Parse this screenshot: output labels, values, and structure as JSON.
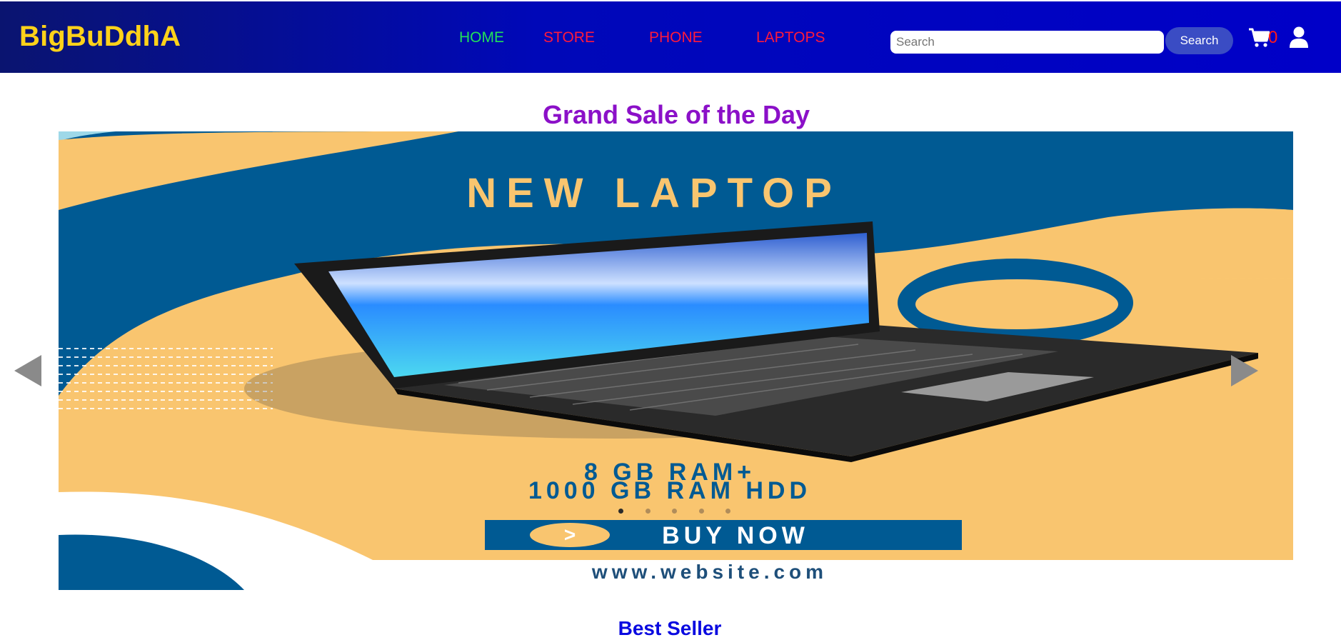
{
  "header": {
    "brand": "BigBuDdhA",
    "nav": [
      {
        "label": "HOME",
        "color": "#22e05a"
      },
      {
        "label": "STORE",
        "color": "#ff1a3c"
      },
      {
        "label": "PHONE",
        "color": "#ff1a3c"
      },
      {
        "label": "LAPTOPS",
        "color": "#ff1a3c"
      }
    ],
    "search": {
      "placeholder": "Search",
      "value": "",
      "button_label": "Search"
    },
    "cart": {
      "icon": "cart-icon",
      "count": "0"
    },
    "user": {
      "icon": "user-icon"
    }
  },
  "main": {
    "sale_title": "Grand Sale of the Day",
    "carousel": {
      "banner_text": {
        "headline": "NEW LAPTOP",
        "spec_line_1": "8 GB RAM+",
        "spec_line_2": "1000 GB RAM HDD",
        "cta": "BUY NOW",
        "website": "www.website.com"
      },
      "slide_count": 5,
      "active_slide": 1,
      "prev_icon": "triangle-left-icon",
      "next_icon": "triangle-right-icon"
    },
    "section_title": "Best Seller"
  },
  "colors": {
    "navbar": "#0000c8",
    "brand": "#ffd21a",
    "sale_title": "#8b10c8",
    "section_title": "#0a0ae0",
    "banner_blue": "#005a93",
    "banner_yellow": "#f9c56f",
    "search_button": "#3a4cc4"
  }
}
